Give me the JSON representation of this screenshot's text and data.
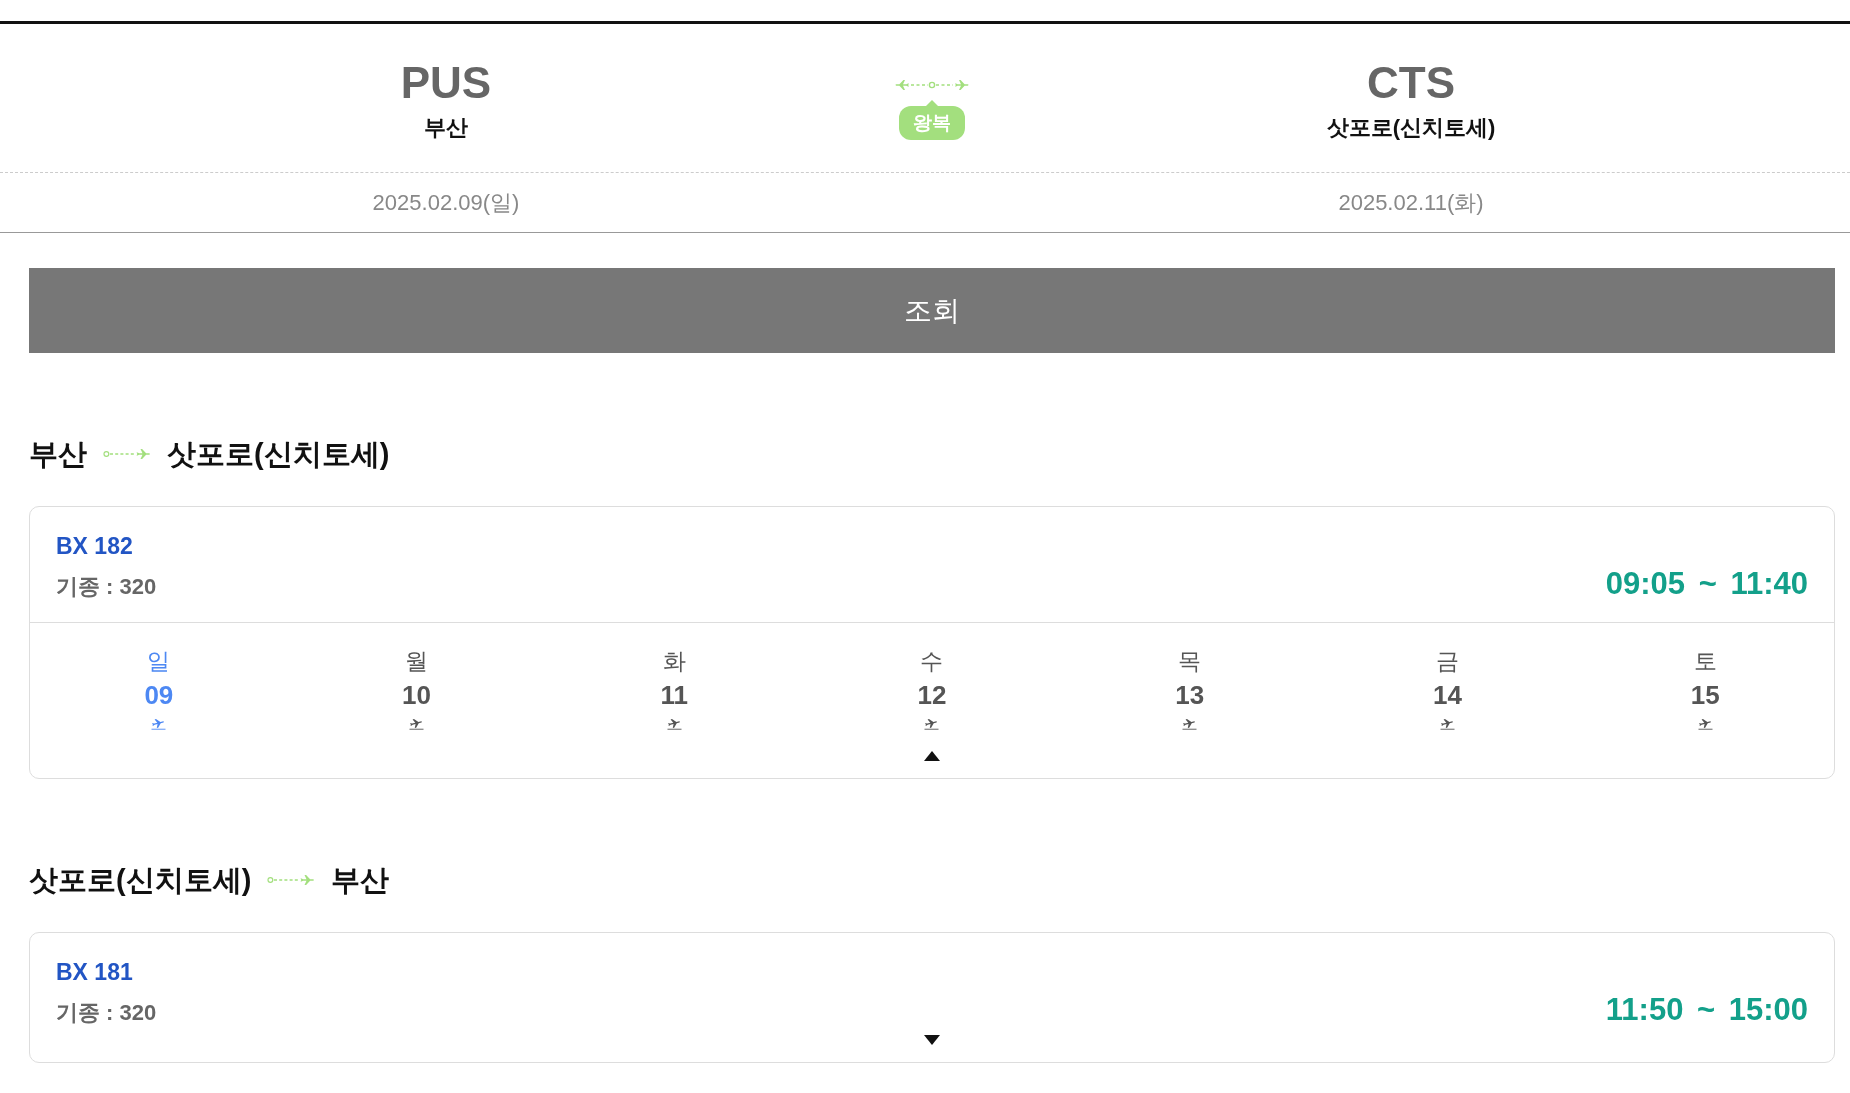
{
  "itinerary": {
    "origin": {
      "code": "PUS",
      "city": "부산",
      "date": "2025.02.09(일)"
    },
    "trip_type": "왕복",
    "destination": {
      "code": "CTS",
      "city": "삿포로(신치토세)",
      "date": "2025.02.11(화)"
    }
  },
  "search_button": "조회",
  "segments": [
    {
      "from": "부산",
      "to": "삿포로(신치토세)",
      "flights": [
        {
          "flight_no": "BX 182",
          "aircraft": "기종 : 320",
          "time": "09:05 ~ 11:40",
          "expanded": true,
          "days": [
            {
              "weekday": "일",
              "date": "09",
              "selected": true
            },
            {
              "weekday": "월",
              "date": "10",
              "selected": false
            },
            {
              "weekday": "화",
              "date": "11",
              "selected": false
            },
            {
              "weekday": "수",
              "date": "12",
              "selected": false
            },
            {
              "weekday": "목",
              "date": "13",
              "selected": false
            },
            {
              "weekday": "금",
              "date": "14",
              "selected": false
            },
            {
              "weekday": "토",
              "date": "15",
              "selected": false
            }
          ]
        }
      ]
    },
    {
      "from": "삿포로(신치토세)",
      "to": "부산",
      "flights": [
        {
          "flight_no": "BX 181",
          "aircraft": "기종 : 320",
          "time": "11:50 ~ 15:00",
          "expanded": false
        }
      ]
    }
  ]
}
